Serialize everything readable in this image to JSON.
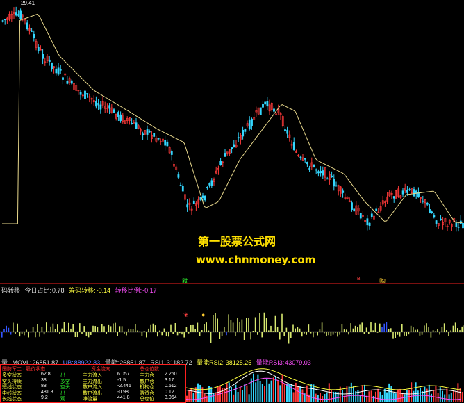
{
  "price_chart": {
    "top_price_label": "29.41",
    "watermark_title": "第一股票公式网",
    "watermark_url": "www.chnmoney.com",
    "colors": {
      "up": "#ff3a3a",
      "down": "#34d7ff",
      "ma": "#e8d88c"
    }
  },
  "signals": {
    "sell_left": "跌",
    "buy_right": "购",
    "small_red": "B"
  },
  "indicator": {
    "name": "码转移",
    "today_ratio_label": "今日占比:",
    "today_ratio_value": "0.78",
    "chip_transfer_label": "筹码转移:",
    "chip_transfer_value": "-0.14",
    "ratio_label": "转移比例:",
    "ratio_value": "-0.17",
    "colors": {
      "bar": "#d8e870",
      "blue": "#3355ff"
    }
  },
  "volume": {
    "name": "量",
    "movl_label": "MOVL:",
    "movl_value": "26851.87",
    "ub_label": "UB:",
    "ub_value": "88922.83",
    "energy_label": "量能:",
    "energy_value": "26851.87",
    "rsi1_label": "RSI1:",
    "rsi1_value": "31182.72",
    "rsi2_label": "量能RSI2:",
    "rsi2_value": "38125.25",
    "rsi3_label": "量能RSI3:",
    "rsi3_value": "43079.03"
  },
  "info_box": {
    "header_left": "国防军工 · 股价状态",
    "header_mid": "资金流向",
    "header_right": "总仓位数",
    "rows": [
      {
        "label": "多空状态",
        "value": "62.8",
        "tag": "出"
      },
      {
        "label": "空头持续",
        "value": "38",
        "tag": "多空"
      },
      {
        "label": "短线状态",
        "value": "88",
        "tag": "空头"
      },
      {
        "label": "中线状态",
        "value": "481.8",
        "tag": "出"
      },
      {
        "label": "长线状态",
        "value": "9.2",
        "tag": "观"
      }
    ],
    "mid_rows": [
      {
        "label": "主力流入",
        "value": "6.057"
      },
      {
        "label": "主力流出",
        "value": "-1.5"
      },
      {
        "label": "散户流入",
        "value": "-2.445"
      },
      {
        "label": "散户流出",
        "value": "-0.98"
      },
      {
        "label": "净流量",
        "value": "441.8"
      }
    ],
    "right_rows": [
      {
        "label": "主力仓",
        "value": "2.260"
      },
      {
        "label": "散户仓",
        "value": "3.17"
      },
      {
        "label": "机构仓",
        "value": "0.512"
      },
      {
        "label": "游资仓",
        "value": "0.12"
      },
      {
        "label": "总仓位",
        "value": "3.064"
      }
    ]
  }
}
